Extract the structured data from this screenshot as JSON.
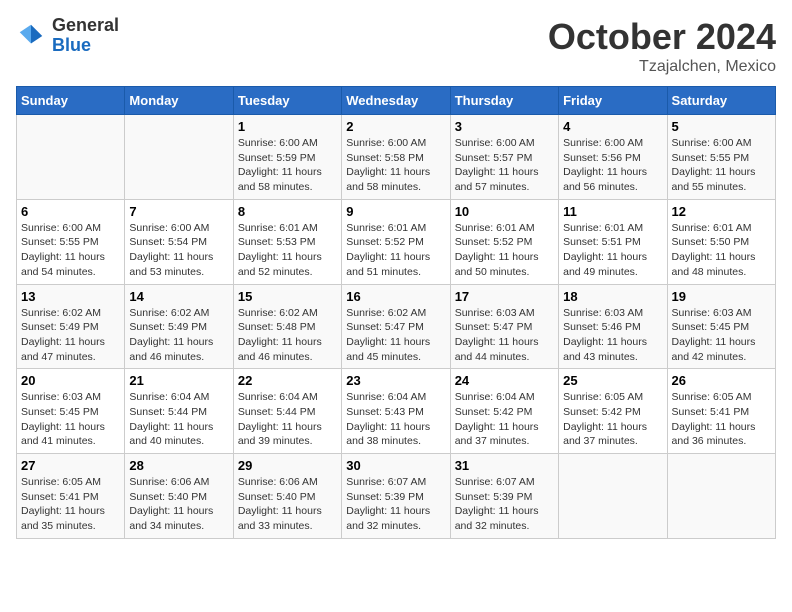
{
  "header": {
    "logo_general": "General",
    "logo_blue": "Blue",
    "month": "October 2024",
    "location": "Tzajalchen, Mexico"
  },
  "weekdays": [
    "Sunday",
    "Monday",
    "Tuesday",
    "Wednesday",
    "Thursday",
    "Friday",
    "Saturday"
  ],
  "weeks": [
    [
      {
        "day": "",
        "sunrise": "",
        "sunset": "",
        "daylight": ""
      },
      {
        "day": "",
        "sunrise": "",
        "sunset": "",
        "daylight": ""
      },
      {
        "day": "1",
        "sunrise": "Sunrise: 6:00 AM",
        "sunset": "Sunset: 5:59 PM",
        "daylight": "Daylight: 11 hours and 58 minutes."
      },
      {
        "day": "2",
        "sunrise": "Sunrise: 6:00 AM",
        "sunset": "Sunset: 5:58 PM",
        "daylight": "Daylight: 11 hours and 58 minutes."
      },
      {
        "day": "3",
        "sunrise": "Sunrise: 6:00 AM",
        "sunset": "Sunset: 5:57 PM",
        "daylight": "Daylight: 11 hours and 57 minutes."
      },
      {
        "day": "4",
        "sunrise": "Sunrise: 6:00 AM",
        "sunset": "Sunset: 5:56 PM",
        "daylight": "Daylight: 11 hours and 56 minutes."
      },
      {
        "day": "5",
        "sunrise": "Sunrise: 6:00 AM",
        "sunset": "Sunset: 5:55 PM",
        "daylight": "Daylight: 11 hours and 55 minutes."
      }
    ],
    [
      {
        "day": "6",
        "sunrise": "Sunrise: 6:00 AM",
        "sunset": "Sunset: 5:55 PM",
        "daylight": "Daylight: 11 hours and 54 minutes."
      },
      {
        "day": "7",
        "sunrise": "Sunrise: 6:00 AM",
        "sunset": "Sunset: 5:54 PM",
        "daylight": "Daylight: 11 hours and 53 minutes."
      },
      {
        "day": "8",
        "sunrise": "Sunrise: 6:01 AM",
        "sunset": "Sunset: 5:53 PM",
        "daylight": "Daylight: 11 hours and 52 minutes."
      },
      {
        "day": "9",
        "sunrise": "Sunrise: 6:01 AM",
        "sunset": "Sunset: 5:52 PM",
        "daylight": "Daylight: 11 hours and 51 minutes."
      },
      {
        "day": "10",
        "sunrise": "Sunrise: 6:01 AM",
        "sunset": "Sunset: 5:52 PM",
        "daylight": "Daylight: 11 hours and 50 minutes."
      },
      {
        "day": "11",
        "sunrise": "Sunrise: 6:01 AM",
        "sunset": "Sunset: 5:51 PM",
        "daylight": "Daylight: 11 hours and 49 minutes."
      },
      {
        "day": "12",
        "sunrise": "Sunrise: 6:01 AM",
        "sunset": "Sunset: 5:50 PM",
        "daylight": "Daylight: 11 hours and 48 minutes."
      }
    ],
    [
      {
        "day": "13",
        "sunrise": "Sunrise: 6:02 AM",
        "sunset": "Sunset: 5:49 PM",
        "daylight": "Daylight: 11 hours and 47 minutes."
      },
      {
        "day": "14",
        "sunrise": "Sunrise: 6:02 AM",
        "sunset": "Sunset: 5:49 PM",
        "daylight": "Daylight: 11 hours and 46 minutes."
      },
      {
        "day": "15",
        "sunrise": "Sunrise: 6:02 AM",
        "sunset": "Sunset: 5:48 PM",
        "daylight": "Daylight: 11 hours and 46 minutes."
      },
      {
        "day": "16",
        "sunrise": "Sunrise: 6:02 AM",
        "sunset": "Sunset: 5:47 PM",
        "daylight": "Daylight: 11 hours and 45 minutes."
      },
      {
        "day": "17",
        "sunrise": "Sunrise: 6:03 AM",
        "sunset": "Sunset: 5:47 PM",
        "daylight": "Daylight: 11 hours and 44 minutes."
      },
      {
        "day": "18",
        "sunrise": "Sunrise: 6:03 AM",
        "sunset": "Sunset: 5:46 PM",
        "daylight": "Daylight: 11 hours and 43 minutes."
      },
      {
        "day": "19",
        "sunrise": "Sunrise: 6:03 AM",
        "sunset": "Sunset: 5:45 PM",
        "daylight": "Daylight: 11 hours and 42 minutes."
      }
    ],
    [
      {
        "day": "20",
        "sunrise": "Sunrise: 6:03 AM",
        "sunset": "Sunset: 5:45 PM",
        "daylight": "Daylight: 11 hours and 41 minutes."
      },
      {
        "day": "21",
        "sunrise": "Sunrise: 6:04 AM",
        "sunset": "Sunset: 5:44 PM",
        "daylight": "Daylight: 11 hours and 40 minutes."
      },
      {
        "day": "22",
        "sunrise": "Sunrise: 6:04 AM",
        "sunset": "Sunset: 5:44 PM",
        "daylight": "Daylight: 11 hours and 39 minutes."
      },
      {
        "day": "23",
        "sunrise": "Sunrise: 6:04 AM",
        "sunset": "Sunset: 5:43 PM",
        "daylight": "Daylight: 11 hours and 38 minutes."
      },
      {
        "day": "24",
        "sunrise": "Sunrise: 6:04 AM",
        "sunset": "Sunset: 5:42 PM",
        "daylight": "Daylight: 11 hours and 37 minutes."
      },
      {
        "day": "25",
        "sunrise": "Sunrise: 6:05 AM",
        "sunset": "Sunset: 5:42 PM",
        "daylight": "Daylight: 11 hours and 37 minutes."
      },
      {
        "day": "26",
        "sunrise": "Sunrise: 6:05 AM",
        "sunset": "Sunset: 5:41 PM",
        "daylight": "Daylight: 11 hours and 36 minutes."
      }
    ],
    [
      {
        "day": "27",
        "sunrise": "Sunrise: 6:05 AM",
        "sunset": "Sunset: 5:41 PM",
        "daylight": "Daylight: 11 hours and 35 minutes."
      },
      {
        "day": "28",
        "sunrise": "Sunrise: 6:06 AM",
        "sunset": "Sunset: 5:40 PM",
        "daylight": "Daylight: 11 hours and 34 minutes."
      },
      {
        "day": "29",
        "sunrise": "Sunrise: 6:06 AM",
        "sunset": "Sunset: 5:40 PM",
        "daylight": "Daylight: 11 hours and 33 minutes."
      },
      {
        "day": "30",
        "sunrise": "Sunrise: 6:07 AM",
        "sunset": "Sunset: 5:39 PM",
        "daylight": "Daylight: 11 hours and 32 minutes."
      },
      {
        "day": "31",
        "sunrise": "Sunrise: 6:07 AM",
        "sunset": "Sunset: 5:39 PM",
        "daylight": "Daylight: 11 hours and 32 minutes."
      },
      {
        "day": "",
        "sunrise": "",
        "sunset": "",
        "daylight": ""
      },
      {
        "day": "",
        "sunrise": "",
        "sunset": "",
        "daylight": ""
      }
    ]
  ]
}
